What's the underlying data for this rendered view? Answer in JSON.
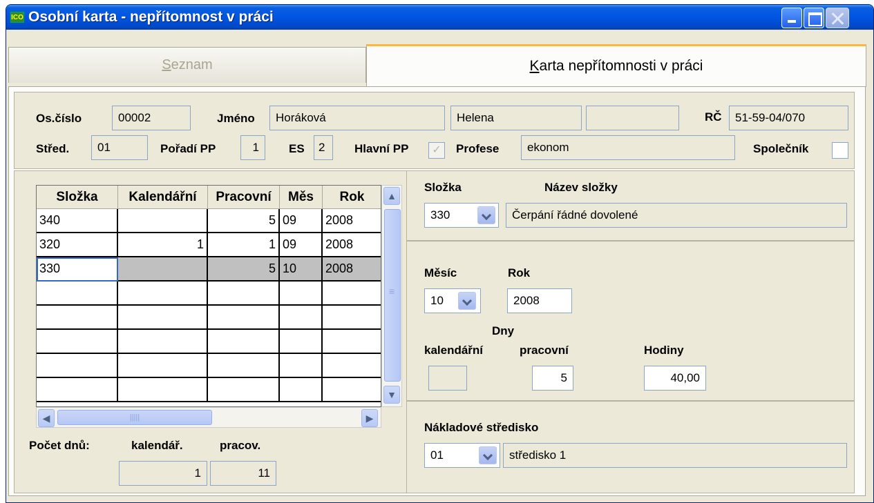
{
  "window": {
    "title": "Osobní karta - nepřítomnost v práci",
    "icon_text": "ICO"
  },
  "tabs": [
    {
      "label": "Seznam",
      "accel": "S",
      "rest": "eznam"
    },
    {
      "label": "Karta nepřítomnosti v práci",
      "accel": "K",
      "rest": "arta nepřítomnosti v práci"
    }
  ],
  "header": {
    "os_cislo_label": "Os.číslo",
    "os_cislo": "00002",
    "jmeno_label": "Jméno",
    "prijmeni": "Horáková",
    "jmeno": "Helena",
    "titul": "",
    "rc_label": "RČ",
    "rc": "51-59-04/070",
    "stred_label": "Střed.",
    "stred": "01",
    "poradi_label": "Pořadí PP",
    "poradi": "1",
    "es_label": "ES",
    "es": "2",
    "hlavni_label": "Hlavní PP",
    "hlavni_checked": true,
    "profese_label": "Profese",
    "profese": "ekonom",
    "spolecnik_label": "Společník",
    "spolecnik_checked": false
  },
  "grid": {
    "columns": [
      "Složka",
      "Kalendářní",
      "Pracovní",
      "Měs",
      "Rok"
    ],
    "rows": [
      [
        "340",
        "",
        "5",
        "09",
        "2008"
      ],
      [
        "320",
        "1",
        "1",
        "09",
        "2008"
      ],
      [
        "330",
        "",
        "5",
        "10",
        "2008"
      ],
      [
        "",
        "",
        "",
        "",
        ""
      ],
      [
        "",
        "",
        "",
        "",
        ""
      ],
      [
        "",
        "",
        "",
        "",
        ""
      ],
      [
        "",
        "",
        "",
        "",
        ""
      ],
      [
        "",
        "",
        "",
        "",
        ""
      ]
    ],
    "selected_row": 2,
    "scroll_thumb": "|||||"
  },
  "totals": {
    "label": "Počet dnů:",
    "kalendar_label": "kalendář.",
    "kalendar_value": "1",
    "pracov_label": "pracov.",
    "pracov_value": "11"
  },
  "slozka": {
    "label": "Složka",
    "nazev_label": "Název složky",
    "value": "330",
    "nazev": "Čerpání řádné dovolené"
  },
  "period": {
    "mesic_label": "Měsíc",
    "mesic": "10",
    "rok_label": "Rok",
    "rok": "2008",
    "dny_label": "Dny",
    "kalendarni_label": "kalendářní",
    "kalendarni": "",
    "pracovni_label": "pracovní",
    "pracovni": "5",
    "hodiny_label": "Hodiny",
    "hodiny": "40,00"
  },
  "cost": {
    "label": "Nákladové středisko",
    "value": "01",
    "name": "středisko 1"
  }
}
